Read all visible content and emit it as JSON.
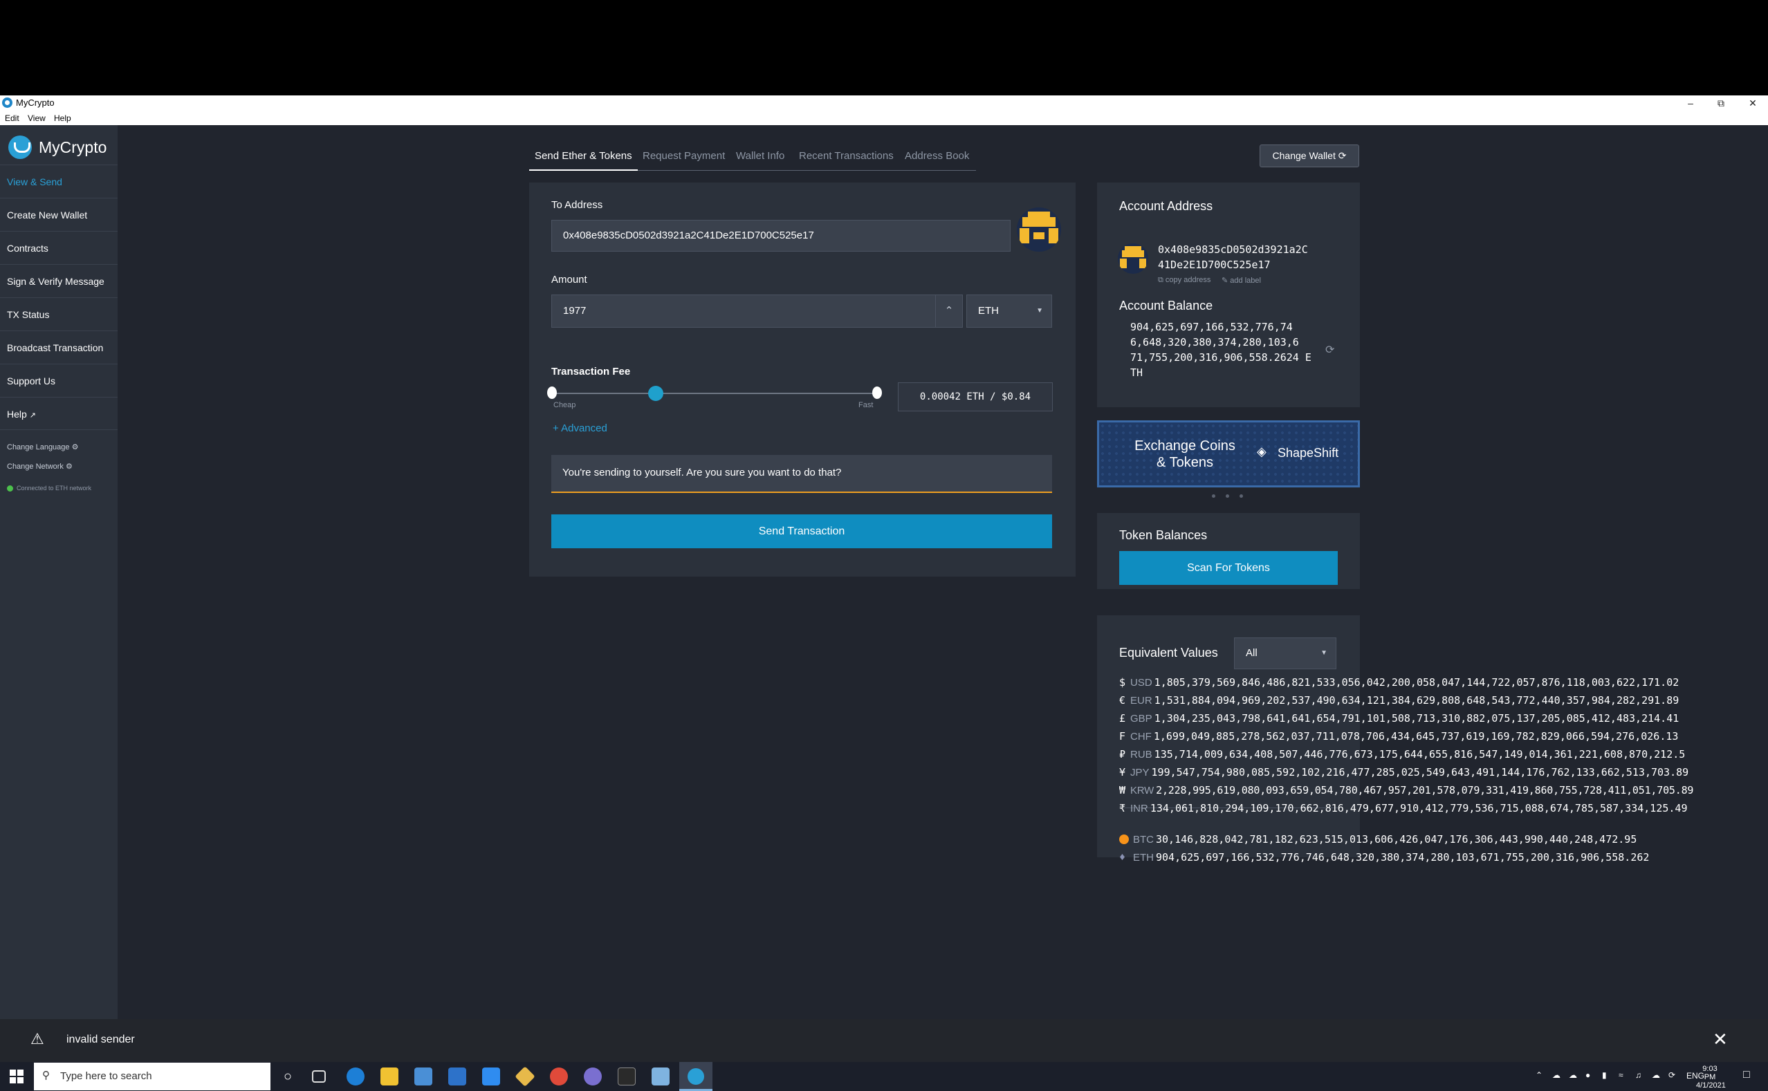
{
  "window": {
    "title": "MyCrypto",
    "menu": [
      "Edit",
      "View",
      "Help"
    ]
  },
  "sidebar": {
    "brand": "MyCrypto",
    "items": [
      {
        "label": "View & Send"
      },
      {
        "label": "Create New Wallet"
      },
      {
        "label": "Contracts"
      },
      {
        "label": "Sign & Verify Message"
      },
      {
        "label": "TX Status"
      },
      {
        "label": "Broadcast Transaction"
      },
      {
        "label": "Support Us"
      },
      {
        "label": "Help"
      }
    ],
    "change_language": "Change Language",
    "change_network": "Change Network",
    "connection": "Connected to ETH network"
  },
  "tabs": [
    "Send Ether & Tokens",
    "Request Payment",
    "Wallet Info",
    "Recent Transactions",
    "Address Book"
  ],
  "change_wallet": "Change Wallet",
  "send": {
    "to_label": "To Address",
    "to_value": "0x408e9835cD0502d3921a2C41De2E1D700C525e17",
    "amount_label": "Amount",
    "amount_value": "1977",
    "unit": "ETH",
    "fee_label": "Transaction Fee",
    "fee_cheap": "Cheap",
    "fee_fast": "Fast",
    "fee_value": "0.00042 ETH / $0.84",
    "fee_level": 0.32,
    "advanced": "+ Advanced",
    "warning": "You're sending to yourself. Are you sure you want to do that?",
    "send_button": "Send Transaction"
  },
  "account": {
    "address_label": "Account Address",
    "address_line1": "0x408e9835cD0502d3921a2C",
    "address_line2": "41De2E1D700C525e17",
    "copy_address": "copy address",
    "add_label": "add label",
    "balance_label": "Account Balance",
    "balance_lines": [
      "904,625,697,166,532,776,74",
      "6,648,320,380,374,280,103,6",
      "71,755,200,316,906,558.2624 E",
      "TH"
    ]
  },
  "promo": {
    "text_line1": "Exchange Coins",
    "text_line2": "& Tokens",
    "brand": "ShapeShift"
  },
  "tokens": {
    "label": "Token Balances",
    "scan_button": "Scan For Tokens"
  },
  "equivalent": {
    "label": "Equivalent Values",
    "filter": "All",
    "fiat": [
      {
        "sym": "$",
        "cur": "USD",
        "value": "1,805,379,569,846,486,821,533,056,042,200,058,047,144,722,057,876,118,003,622,171.02"
      },
      {
        "sym": "€",
        "cur": "EUR",
        "value": "1,531,884,094,969,202,537,490,634,121,384,629,808,648,543,772,440,357,984,282,291.89"
      },
      {
        "sym": "£",
        "cur": "GBP",
        "value": "1,304,235,043,798,641,641,654,791,101,508,713,310,882,075,137,205,085,412,483,214.41"
      },
      {
        "sym": "F",
        "cur": "CHF",
        "value": "1,699,049,885,278,562,037,711,078,706,434,645,737,619,169,782,829,066,594,276,026.13"
      },
      {
        "sym": "₽",
        "cur": "RUB",
        "value": "135,714,009,634,408,507,446,776,673,175,644,655,816,547,149,014,361,221,608,870,212.5"
      },
      {
        "sym": "¥",
        "cur": "JPY",
        "value": "199,547,754,980,085,592,102,216,477,285,025,549,643,491,144,176,762,133,662,513,703.89"
      },
      {
        "sym": "₩",
        "cur": "KRW",
        "value": "2,228,995,619,080,093,659,054,780,467,957,201,578,079,331,419,860,755,728,411,051,705.89"
      },
      {
        "sym": "₹",
        "cur": "INR",
        "value": "134,061,810,294,109,170,662,816,479,677,910,412,779,536,715,088,674,785,587,334,125.49"
      }
    ],
    "crypto": [
      {
        "cur": "BTC",
        "value": "30,146,828,042,781,182,623,515,013,606,426,047,176,306,443,990,440,248,472.95",
        "color": "#f7931a"
      },
      {
        "cur": "ETH",
        "value": "904,625,697,166,532,776,746,648,320,380,374,280,103,671,755,200,316,906,558.262",
        "color": "#8a92b2"
      }
    ]
  },
  "notification": {
    "text": "invalid sender"
  },
  "taskbar": {
    "search_placeholder": "Type here to search",
    "time": "9:03 PM",
    "date": "4/1/2021",
    "lang": "ENG"
  },
  "colors": {
    "accent": "#0f8dc0",
    "warning": "#f0a020",
    "bg": "#21252e",
    "panel": "#2b313b"
  }
}
